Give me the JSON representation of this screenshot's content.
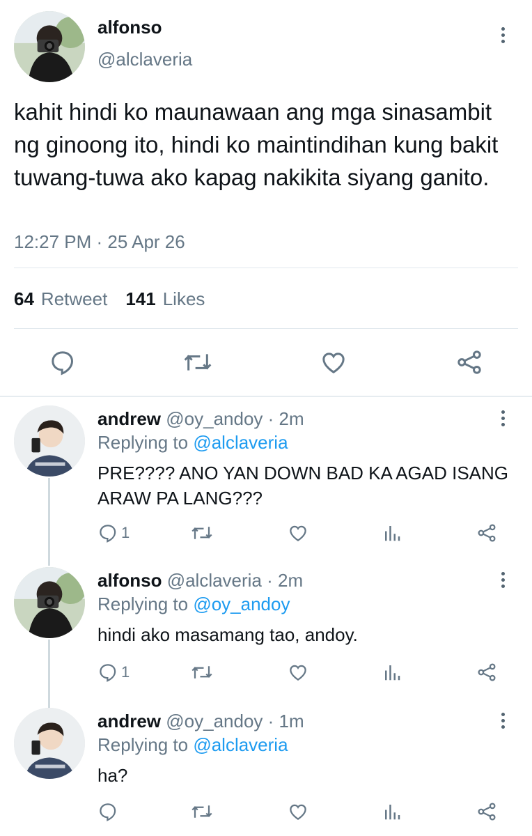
{
  "main_tweet": {
    "author_name": "alfonso",
    "author_handle": "@alclaveria",
    "text": "kahit hindi ko maunawaan ang mga sinasambit ng ginoong ito, hindi ko maintindihan kung bakit tuwang-tuwa ako kapag nakikita siyang ganito.",
    "timestamp": "12:27 PM · 25 Apr 26",
    "retweet_count": "64",
    "retweet_label": "Retweet",
    "likes_count": "141",
    "likes_label": "Likes",
    "actions": [
      "reply-icon",
      "retweet-icon",
      "like-icon",
      "share-icon"
    ]
  },
  "replies": [
    {
      "author_name": "andrew",
      "author_handle": "@oy_andoy",
      "time": "· 2m",
      "replying_prefix": "Replying to",
      "replying_to": "@alclaveria",
      "text": "PRE???? ANO YAN DOWN BAD KA AGAD ISANG ARAW PA LANG???",
      "reply_count": "1"
    },
    {
      "author_name": "alfonso",
      "author_handle": "@alclaveria",
      "time": "· 2m",
      "replying_prefix": "Replying to",
      "replying_to": "@oy_andoy",
      "text": "hindi ako masamang tao, andoy.",
      "reply_count": "1"
    },
    {
      "author_name": "andrew",
      "author_handle": "@oy_andoy",
      "time": "· 1m",
      "replying_prefix": "Replying to",
      "replying_to": "@alclaveria",
      "text": "ha?",
      "reply_count": ""
    }
  ],
  "colors": {
    "link": "#1d9bf0",
    "muted": "#657786",
    "divider": "#e1e8ed",
    "thread_line": "#cfd9de"
  }
}
